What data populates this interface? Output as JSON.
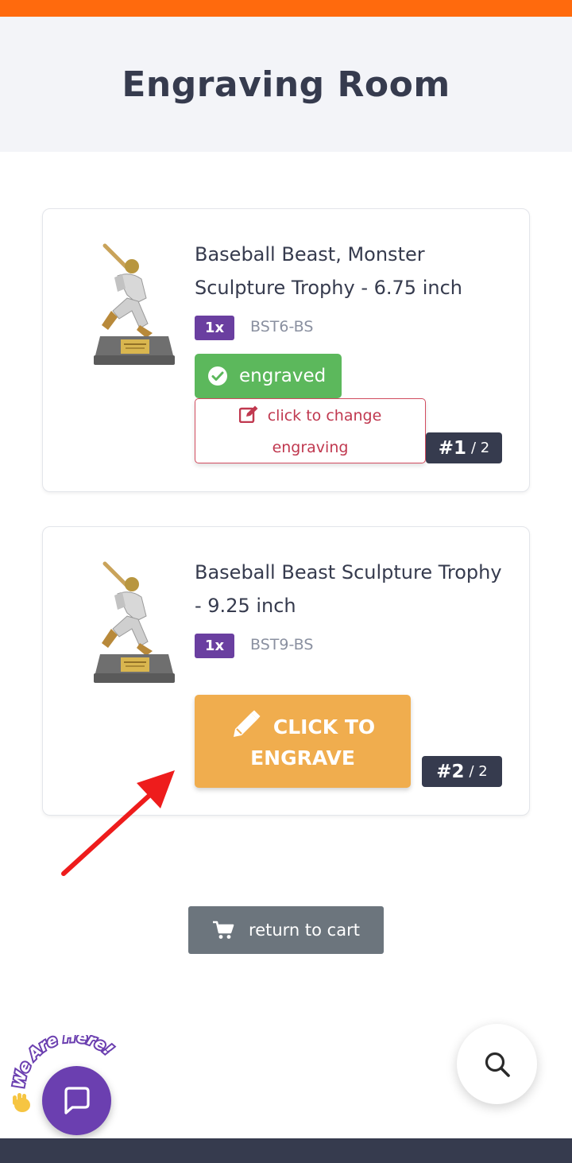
{
  "header": {
    "title": "Engraving Room"
  },
  "items": [
    {
      "name": "Baseball Beast, Monster Sculpture Trophy - 6.75 inch",
      "qty": "1x",
      "sku": "BST6-BS",
      "status": "engraved",
      "change_label_line1": "click to change",
      "change_label_line2": "engraving",
      "index": "#1",
      "total": "/ 2"
    },
    {
      "name": "Baseball Beast Sculpture Trophy - 9.25 inch",
      "qty": "1x",
      "sku": "BST9-BS",
      "engrave_label_line1": "CLICK TO",
      "engrave_label_line2": "ENGRAVE",
      "index": "#2",
      "total": "/ 2"
    }
  ],
  "actions": {
    "return_to_cart": "return to cart"
  },
  "chat": {
    "badge_text": "We Are Here!"
  },
  "colors": {
    "accent": "#ff6a0d",
    "qty_badge": "#6a3fa0",
    "engraved": "#5cb85c",
    "engrave_button": "#f0ad4e",
    "change_border": "#d24c5f",
    "dark": "#363b4e",
    "return_button": "#6c757d"
  },
  "icons": [
    "check-circle-icon",
    "edit-icon",
    "pencil-icon",
    "cart-icon",
    "chat-icon",
    "search-icon",
    "red-arrow-annotation"
  ]
}
